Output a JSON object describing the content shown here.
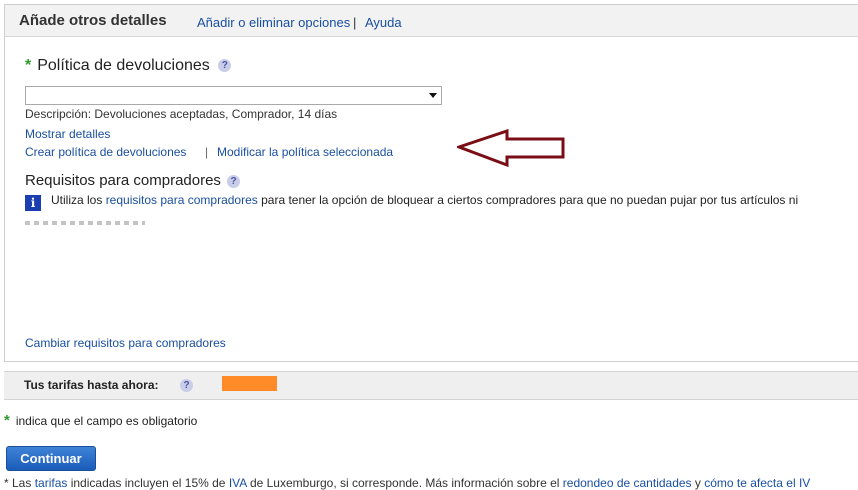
{
  "section": {
    "title": "Añade otros detalles",
    "links": [
      "Añadir o eliminar opciones",
      "Ayuda"
    ],
    "separator": "|"
  },
  "return_policy": {
    "label": "Política de devoluciones",
    "required_marker": "*",
    "help": "?",
    "select_value": "",
    "description": "Descripción: Devoluciones aceptadas, Comprador, 14 días",
    "show_details": "Mostrar detalles",
    "create_link": "Crear política de devoluciones",
    "separator": "|",
    "modify_link": "Modificar la política seleccionada"
  },
  "annotation": {
    "arrow_color": "#7a0e16"
  },
  "buyer_requirements": {
    "title": "Requisitos para compradores",
    "help": "?",
    "info_icon": "i",
    "info_prefix": "Utiliza los ",
    "info_link": "requisitos para compradores",
    "info_suffix": " para tener la opción de bloquear a ciertos compradores para que no puedan pujar por tus artículos ni",
    "change_link": "Cambiar requisitos para compradores"
  },
  "tariffs": {
    "label": "Tus tarifas hasta ahora:",
    "help": "?",
    "amount_color": "#ff8a27"
  },
  "legend": {
    "marker": "*",
    "text": "indica que el campo es obligatorio"
  },
  "continue_button": "Continuar",
  "footer": {
    "text_1": "* Las ",
    "link_1": "tarifas",
    "text_2": " indicadas incluyen el 15% de ",
    "link_2": "IVA",
    "text_3": " de Luxemburgo, si corresponde. Más información sobre el ",
    "link_3": "redondeo de cantidades",
    "text_4": " y ",
    "link_4": "cómo te afecta el IV"
  },
  "colors": {
    "link": "#1a4fa0",
    "required_star": "#2f9a2f",
    "info_icon_bg": "#1b3fb0",
    "button_bg": "#1a5cb8"
  }
}
